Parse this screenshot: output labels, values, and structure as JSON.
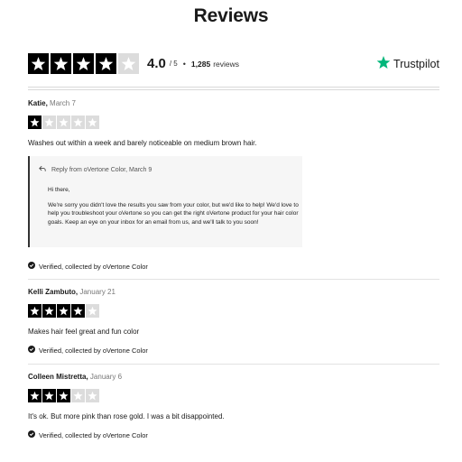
{
  "page": {
    "title": "Reviews"
  },
  "summary": {
    "rating": 4,
    "score": "4.0",
    "score_max": "/ 5",
    "separator": "•",
    "review_count": "1,285",
    "review_count_label": "reviews",
    "provider": "Trustpilot"
  },
  "colors": {
    "star_filled": "#000000",
    "star_empty": "#dcdcdc",
    "trustpilot_green": "#00b67a"
  },
  "reviews": [
    {
      "name": "Katie,",
      "date": "March 7",
      "rating": 1,
      "text": "Washes out within a week and barely noticeable on medium brown hair.",
      "verified": "Verified, collected by oVertone Color",
      "reply": {
        "header": "Reply from oVertone Color, March 9",
        "greeting": "Hi there,",
        "message": "We're sorry you didn't love the results you saw from your color, but we'd like to help! We'd love to help you troubleshoot your oVertone so you can get the right oVertone product for your hair color goals. Keep an eye on your inbox for an email from us, and we'll talk to you soon!"
      }
    },
    {
      "name": "Kelli Zambuto,",
      "date": "January 21",
      "rating": 4,
      "text": "Makes hair feel great and fun color",
      "verified": "Verified, collected by oVertone Color"
    },
    {
      "name": "Colleen Mistretta,",
      "date": "January 6",
      "rating": 3,
      "text": "It's ok. But more pink than rose gold. I was a bit disappointed.",
      "verified": "Verified, collected by oVertone Color"
    }
  ]
}
